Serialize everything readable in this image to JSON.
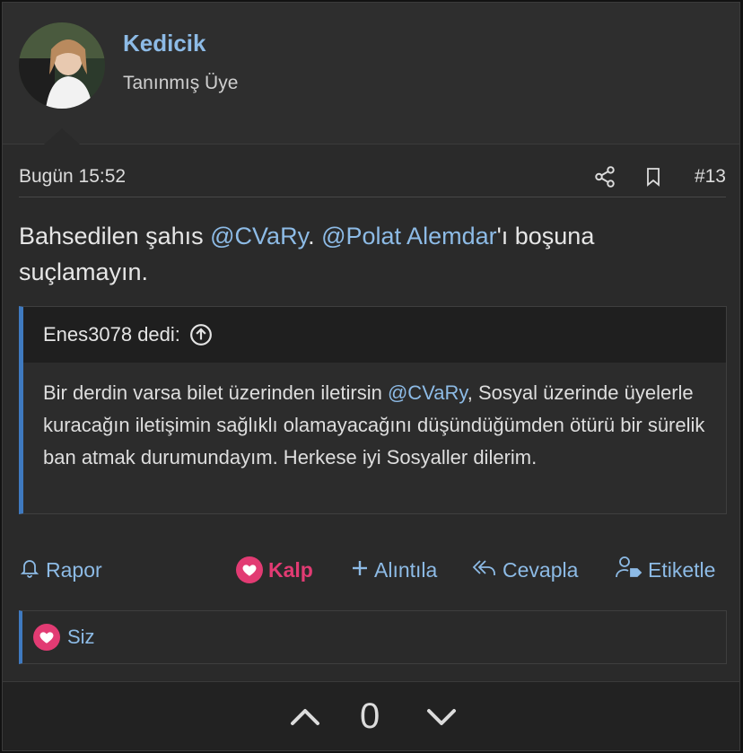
{
  "user": {
    "name": "Kedicik",
    "title": "Tanınmış Üye"
  },
  "post": {
    "date": "Bugün 15:52",
    "number": "#13",
    "body_prefix": "Bahsedilen şahıs ",
    "mention1": "@CVaRy",
    "body_mid": ". ",
    "mention2": "@Polat Alemdar",
    "body_suffix": "'ı boşuna suçlamayın."
  },
  "quote": {
    "author_line": "Enes3078 dedi:",
    "text_prefix": "Bir derdin varsa bilet üzerinden iletirsin ",
    "mention": "@CVaRy",
    "text_suffix": ", Sosyal üzerinde üyelerle kuracağın iletişimin sağlıklı olamayacağını düşündüğümden ötürü bir sürelik ban atmak durumundayım. Herkese iyi Sosyaller dilerim."
  },
  "actions": {
    "report": "Rapor",
    "like": "Kalp",
    "quote": "Alıntıla",
    "reply": "Cevapla",
    "tag": "Etiketle"
  },
  "reactions": {
    "label": "Siz"
  },
  "votes": {
    "count": "0"
  },
  "colors": {
    "accent": "#8dbbe6",
    "like": "#e23b73",
    "quote_border": "#3f7ac0"
  }
}
